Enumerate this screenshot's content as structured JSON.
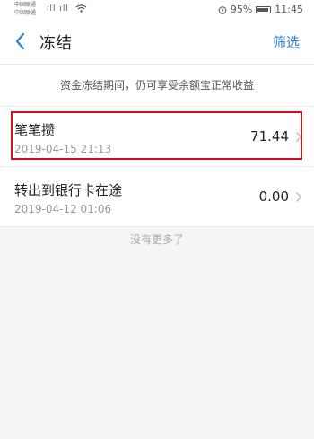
{
  "status_bar": {
    "carrier_1": "中国联通",
    "carrier_2": "中国联通",
    "signal_icons": "ıll ıll",
    "battery_pct": "95%",
    "time": "11:45"
  },
  "nav": {
    "title": "冻结",
    "filter_label": "筛选"
  },
  "notice": "资金冻结期间，仍可享受余额宝正常收益",
  "items": [
    {
      "name": "笔笔攒",
      "date": "2019-04-15 21:13",
      "amount": "71.44"
    },
    {
      "name": "转出到银行卡在途",
      "date": "2019-04-12 01:06",
      "amount": "0.00"
    }
  ],
  "footer": "没有更多了",
  "colors": {
    "accent": "#2a84d8",
    "highlight": "#d0111b"
  }
}
